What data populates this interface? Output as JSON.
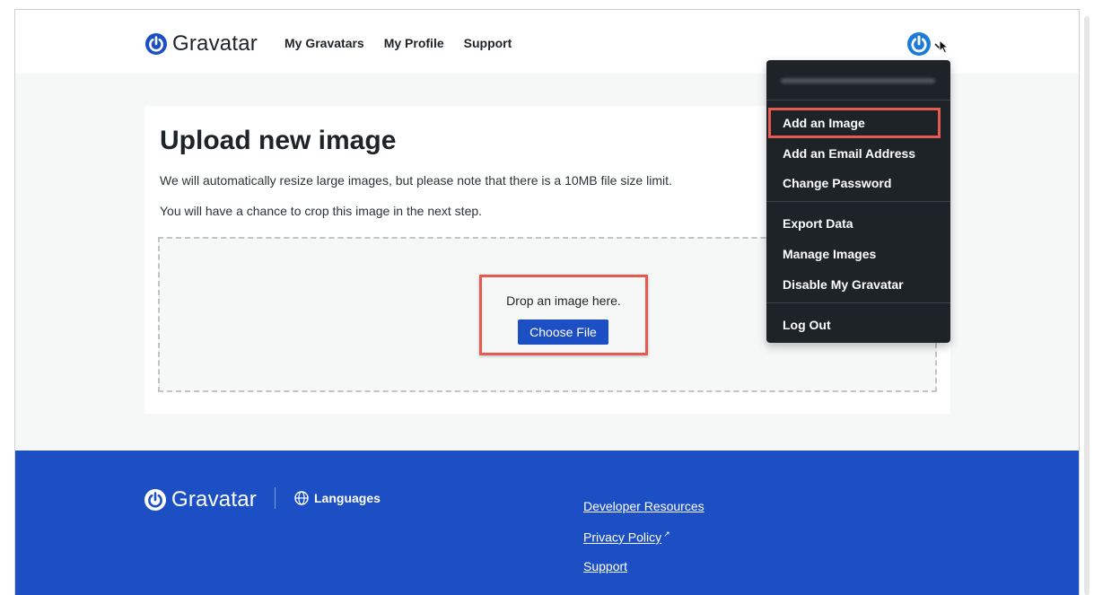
{
  "header": {
    "brand": "Gravatar",
    "nav": [
      "My Gravatars",
      "My Profile",
      "Support"
    ]
  },
  "dropdown": {
    "email": "",
    "items_group1": [
      "Add an Image",
      "Add an Email Address",
      "Change Password"
    ],
    "items_group2": [
      "Export Data",
      "Manage Images",
      "Disable My Gravatar"
    ],
    "items_group3": [
      "Log Out"
    ]
  },
  "main": {
    "title": "Upload new image",
    "note1": "We will automatically resize large images, but please note that there is a 10MB file size limit.",
    "note2": "You will have a chance to crop this image in the next step.",
    "drop_text": "Drop an image here.",
    "choose_button": "Choose File"
  },
  "footer": {
    "brand": "Gravatar",
    "languages": "Languages",
    "links": [
      "Developer Resources",
      "Privacy Policy",
      "Support"
    ]
  },
  "colors": {
    "brand_blue": "#1d4fc4",
    "dropdown_bg": "#1d2327",
    "highlight_red": "#e65a4f"
  },
  "icons": {
    "logo": "gravatar-power-icon",
    "avatar": "gravatar-power-icon",
    "chevron": "chevron-down-icon",
    "cursor": "mouse-pointer-icon",
    "globe": "globe-icon",
    "external": "external-link-icon"
  }
}
